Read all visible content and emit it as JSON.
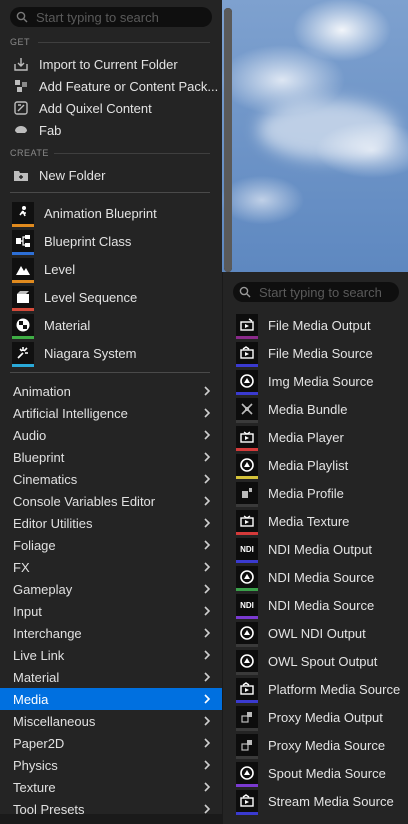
{
  "menu": {
    "search": {
      "placeholder": "Start typing to search"
    },
    "sections": {
      "get": "GET",
      "create": "CREATE"
    },
    "get_items": [
      {
        "label": "Import to Current Folder",
        "icon": "import-icon"
      },
      {
        "label": "Add Feature or Content Pack...",
        "icon": "content-pack-icon"
      },
      {
        "label": "Add Quixel Content",
        "icon": "quixel-icon"
      },
      {
        "label": "Fab",
        "icon": "fab-icon"
      }
    ],
    "create_items": [
      {
        "label": "New Folder",
        "icon": "new-folder-icon"
      }
    ],
    "assets": [
      {
        "label": "Animation Blueprint",
        "color": "#e08a1e"
      },
      {
        "label": "Blueprint Class",
        "color": "#2d6fd6"
      },
      {
        "label": "Level",
        "color": "#e08a1e"
      },
      {
        "label": "Level Sequence",
        "color": "#d44a3a"
      },
      {
        "label": "Material",
        "color": "#3fae45"
      },
      {
        "label": "Niagara System",
        "color": "#2aa9d8"
      }
    ],
    "categories": [
      "Animation",
      "Artificial Intelligence",
      "Audio",
      "Blueprint",
      "Cinematics",
      "Console Variables Editor",
      "Editor Utilities",
      "Foliage",
      "FX",
      "Gameplay",
      "Input",
      "Interchange",
      "Live Link",
      "Material",
      "Media",
      "Miscellaneous",
      "Paper2D",
      "Physics",
      "Texture",
      "Tool Presets"
    ],
    "selected_category": "Media",
    "accent": "#0070e0"
  },
  "submenu": {
    "search": {
      "placeholder": "Start typing to search"
    },
    "items": [
      {
        "label": "File Media Output",
        "icon": "media-output-icon",
        "color": "#8a2a8a"
      },
      {
        "label": "File Media Source",
        "icon": "media-source-icon",
        "color": "#3a3ad0"
      },
      {
        "label": "Img Media Source",
        "icon": "img-source-icon",
        "color": "#3a3ad0"
      },
      {
        "label": "Media Bundle",
        "icon": "media-bundle-icon",
        "color": "#3a3a3a"
      },
      {
        "label": "Media Player",
        "icon": "media-player-icon",
        "color": "#d43a3a"
      },
      {
        "label": "Media Playlist",
        "icon": "playlist-icon",
        "color": "#d4c23a"
      },
      {
        "label": "Media Profile",
        "icon": "profile-icon",
        "color": "#3a3a3a"
      },
      {
        "label": "Media Texture",
        "icon": "texture-icon",
        "color": "#d43a3a"
      },
      {
        "label": "NDI Media Output",
        "icon": "ndi-icon",
        "color": "#3a3ad0"
      },
      {
        "label": "NDI Media Source",
        "icon": "ndi-source-icon",
        "color": "#3aa04a"
      },
      {
        "label": "NDI Media Source",
        "icon": "ndi-icon",
        "color": "#7a3ad0"
      },
      {
        "label": "OWL NDI Output",
        "icon": "owl-icon",
        "color": "#3a3a3a"
      },
      {
        "label": "OWL Spout Output",
        "icon": "owl-icon",
        "color": "#3a3a3a"
      },
      {
        "label": "Platform Media Source",
        "icon": "platform-source-icon",
        "color": "#3a3ad0"
      },
      {
        "label": "Proxy Media Output",
        "icon": "proxy-icon",
        "color": "#3a3a3a"
      },
      {
        "label": "Proxy Media Source",
        "icon": "proxy-icon",
        "color": "#3a3a3a"
      },
      {
        "label": "Spout Media Source",
        "icon": "spout-icon",
        "color": "#7a3ad0"
      },
      {
        "label": "Stream Media Source",
        "icon": "stream-icon",
        "color": "#3a3ad0"
      }
    ]
  }
}
